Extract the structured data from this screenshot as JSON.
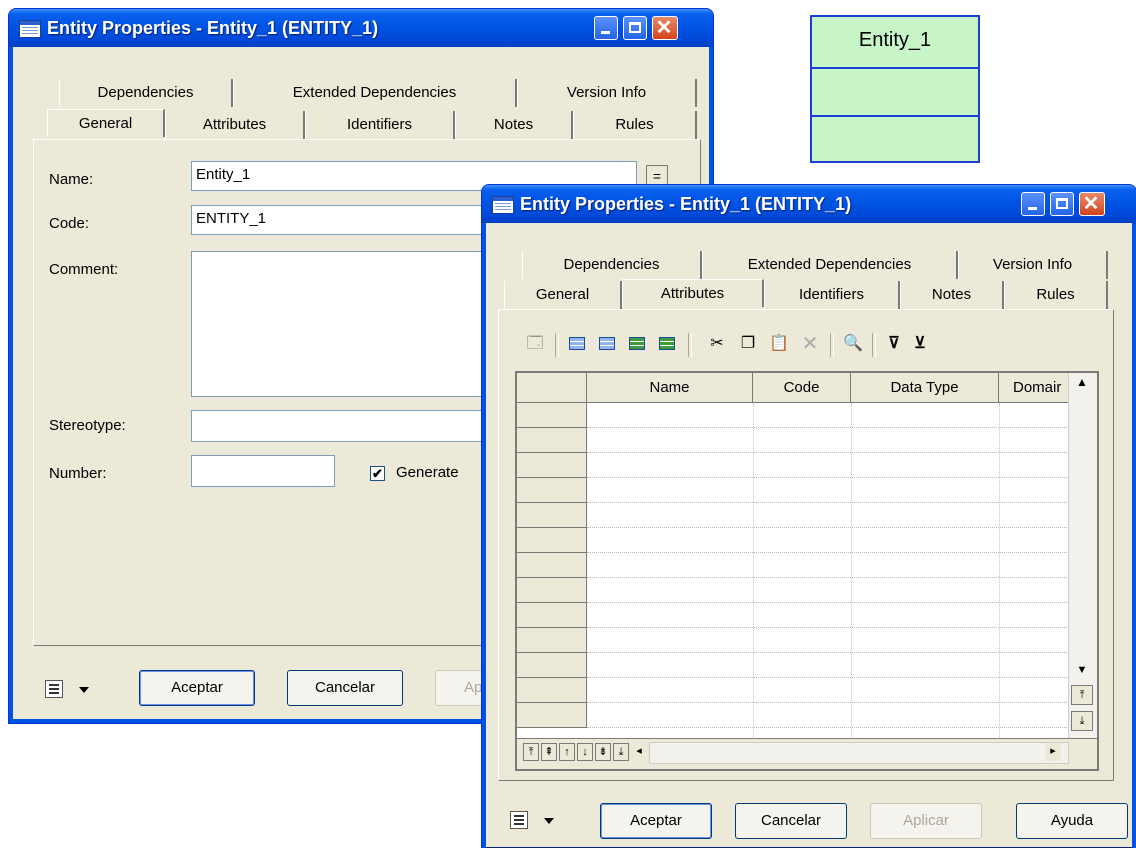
{
  "entity_symbol": {
    "name": "Entity_1"
  },
  "window_back": {
    "title": "Entity Properties - Entity_1 (ENTITY_1)",
    "tabs_row1": [
      "Dependencies",
      "Extended Dependencies",
      "Version Info"
    ],
    "tabs_row2": [
      "General",
      "Attributes",
      "Identifiers",
      "Notes",
      "Rules"
    ],
    "active_tab": "General",
    "form": {
      "name_label": "Name:",
      "name_value": "Entity_1",
      "name_button": "=",
      "code_label": "Code:",
      "code_value": "ENTITY_1",
      "comment_label": "Comment:",
      "stereotype_label": "Stereotype:",
      "number_label": "Number:",
      "generate_label": "Generate",
      "generate_checked": true
    },
    "buttons": {
      "accept": "Aceptar",
      "cancel": "Cancelar",
      "apply": "Ap"
    }
  },
  "window_front": {
    "title": "Entity Properties - Entity_1 (ENTITY_1)",
    "tabs_row1": [
      "Dependencies",
      "Extended Dependencies",
      "Version Info"
    ],
    "tabs_row2": [
      "General",
      "Attributes",
      "Identifiers",
      "Notes",
      "Rules"
    ],
    "active_tab": "Attributes",
    "toolbar_icons": [
      "properties-icon",
      "add-row-icon",
      "insert-row-icon",
      "add-attributes-icon",
      "reuse-attributes-icon",
      "cut-icon",
      "copy-icon",
      "paste-icon",
      "delete-icon",
      "find-icon",
      "customize-columns-icon",
      "filter-icon"
    ],
    "grid": {
      "columns": [
        "Name",
        "Code",
        "Data Type",
        "Domair"
      ]
    },
    "buttons": {
      "accept": "Aceptar",
      "cancel": "Cancelar",
      "apply": "Aplicar",
      "help": "Ayuda"
    }
  }
}
